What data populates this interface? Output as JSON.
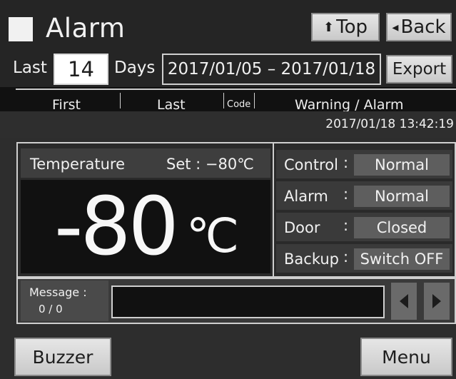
{
  "header": {
    "title": "Alarm",
    "top_label": "Top",
    "back_label": "Back"
  },
  "range": {
    "last_label": "Last",
    "days_value": "14",
    "days_label": "Days",
    "date_range": "2017/01/05 – 2017/01/18",
    "export_label": "Export"
  },
  "log": {
    "columns": [
      "First",
      "Last",
      "Code",
      "Warning / Alarm"
    ],
    "datetime": "2017/01/18  13:42:19"
  },
  "temperature": {
    "label": "Temperature",
    "set_label": "Set :  −80℃",
    "value": "-80",
    "unit": "℃"
  },
  "status": [
    {
      "label": "Control",
      "value": "Normal"
    },
    {
      "label": "Alarm",
      "value": "Normal"
    },
    {
      "label": "Door",
      "value": "Closed"
    },
    {
      "label": "Backup",
      "value": "Switch OFF"
    }
  ],
  "message": {
    "label": "Message :",
    "count": "0 / 0",
    "text": ""
  },
  "footer": {
    "buzzer_label": "Buzzer",
    "menu_label": "Menu"
  },
  "colors": {
    "background": "#2d2d2d",
    "button": "#d8d8d8",
    "status_value_bg": "#5e5e5e",
    "temp_display_bg": "#111111"
  },
  "icons": [
    "square-icon",
    "arrow-up-icon",
    "triangle-left-icon",
    "arrow-left-icon",
    "arrow-right-icon"
  ]
}
